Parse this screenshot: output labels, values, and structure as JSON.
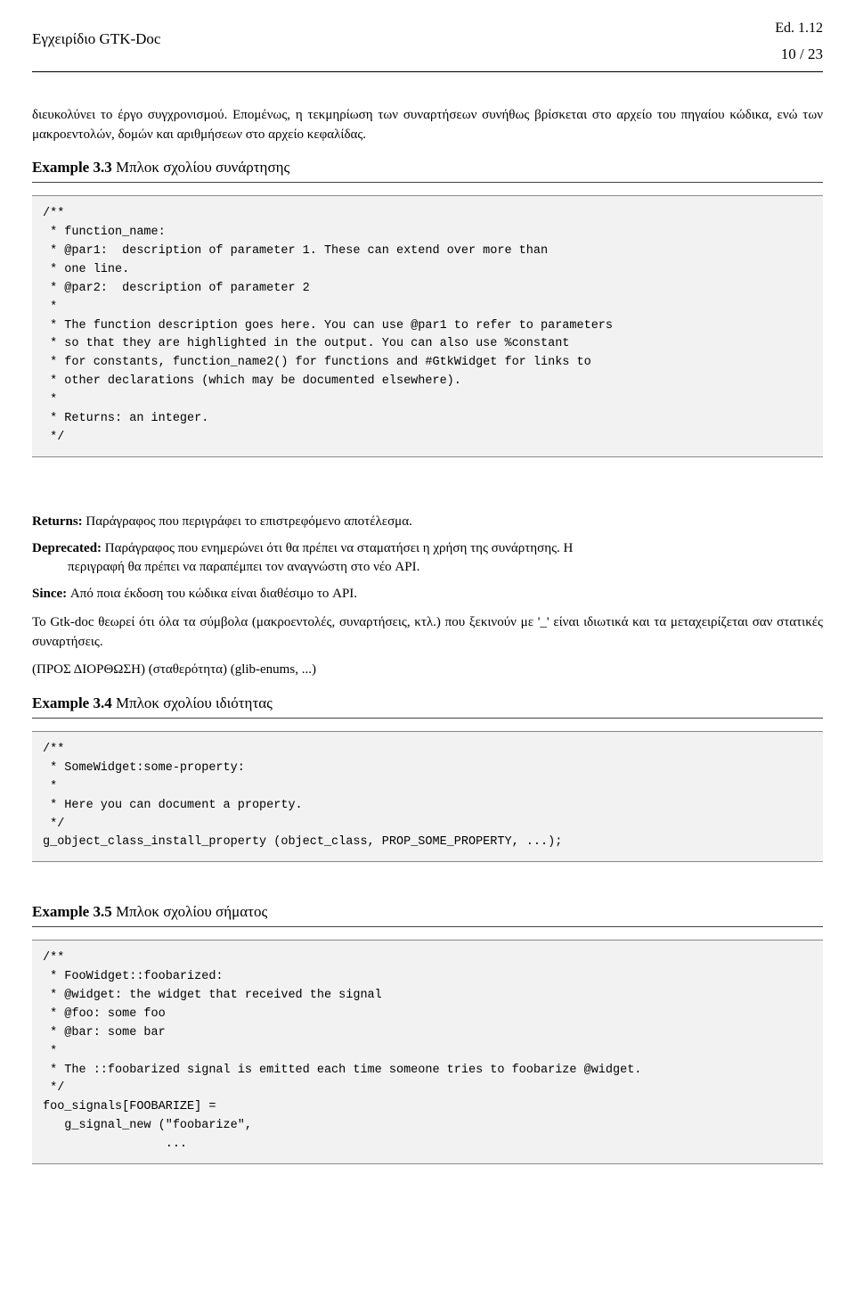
{
  "header": {
    "title": "Εγχειρίδιο GTK-Doc",
    "edition": "Ed. 1.12",
    "pageinfo": "10 / 23"
  },
  "intro_para": "διευκολύνει το έργο συγχρονισμού. Επομένως, η τεκμηρίωση των συναρτήσεων συνήθως βρίσκεται στο αρχείο του πηγαίου κώδικα, ενώ των μακροεντολών, δομών και αριθμήσεων στο αρχείο κεφαλίδας.",
  "ex33": {
    "label": "Example 3.3",
    "title": " Μπλοκ σχολίου συνάρτησης",
    "code": "/**\n * function_name:\n * @par1:  description of parameter 1. These can extend over more than\n * one line.\n * @par2:  description of parameter 2\n *\n * The function description goes here. You can use @par1 to refer to parameters\n * so that they are highlighted in the output. You can also use %constant\n * for constants, function_name2() for functions and #GtkWidget for links to\n * other declarations (which may be documented elsewhere).\n *\n * Returns: an integer.\n */"
  },
  "defs": {
    "returns": {
      "term": "Returns:",
      "desc": " Παράγραφος που περιγράφει το επιστρεφόμενο αποτέλεσμα."
    },
    "deprecated": {
      "term": "Deprecated:",
      "desc": " Παράγραφος που ενημερώνει ότι θα πρέπει να σταματήσει η χρήση της συνάρτησης. Η",
      "cont": "περιγραφή θα πρέπει να παραπέμπει τον αναγνώστη στο νέο API."
    },
    "since": {
      "term": "Since:",
      "desc": " Από ποια έκδοση του κώδικα είναι διαθέσιμο το API."
    }
  },
  "para2": "Το Gtk-doc θεωρεί ότι όλα τα σύμβολα (μακροεντολές, συναρτήσεις, κτλ.) που ξεκινούν με '_' είναι ιδιωτικά και τα μεταχειρίζεται σαν στατικές συναρτήσεις.",
  "para3": "(ΠΡΟΣ ΔΙΟΡΘΩΣΗ) (σταθερότητα) (glib-enums, ...)",
  "ex34": {
    "label": "Example 3.4",
    "title": " Μπλοκ σχολίου ιδιότητας",
    "code": "/**\n * SomeWidget:some-property:\n *\n * Here you can document a property.\n */\ng_object_class_install_property (object_class, PROP_SOME_PROPERTY, ...);"
  },
  "ex35": {
    "label": "Example 3.5",
    "title": " Μπλοκ σχολίου σήματος",
    "code": "/**\n * FooWidget::foobarized:\n * @widget: the widget that received the signal\n * @foo: some foo\n * @bar: some bar\n *\n * The ::foobarized signal is emitted each time someone tries to foobarize @widget.\n */\nfoo_signals[FOOBARIZE] =\n   g_signal_new (\"foobarize\",\n                 ..."
  }
}
